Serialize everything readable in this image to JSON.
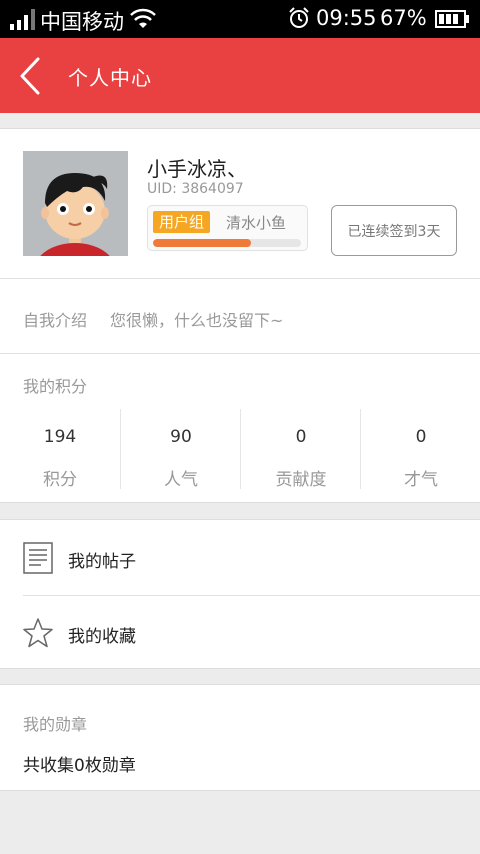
{
  "status_bar": {
    "carrier": "中国移动",
    "time": "09:55",
    "battery": "67%",
    "icons": [
      "signal-icon",
      "wifi-icon",
      "alarm-icon",
      "battery-icon"
    ]
  },
  "header": {
    "title": "个人中心",
    "back_icon": "chevron-left-icon",
    "background": "#e94141"
  },
  "profile": {
    "username": "小手冰凉、",
    "uid": "UID: 3864097",
    "group_tag": "用户组",
    "group_name": "清水小鱼",
    "level_progress": 0.66,
    "signin_label": "已连续签到3天"
  },
  "intro": {
    "label": "自我介绍",
    "text": "您很懒，什么也没留下~"
  },
  "points": {
    "title": "我的积分",
    "stats": [
      {
        "value": "194",
        "label": "积分"
      },
      {
        "value": "90",
        "label": "人气"
      },
      {
        "value": "0",
        "label": "贡献度"
      },
      {
        "value": "0",
        "label": "才气"
      }
    ]
  },
  "menu": {
    "items": [
      {
        "label": "我的帖子",
        "icon": "document-icon"
      },
      {
        "label": "我的收藏",
        "icon": "star-icon"
      }
    ]
  },
  "medals": {
    "title": "我的勋章",
    "summary": "共收集0枚勋章"
  },
  "colors": {
    "accent": "#e94141",
    "tag": "#f5a623",
    "progress": "#f07a3a"
  }
}
